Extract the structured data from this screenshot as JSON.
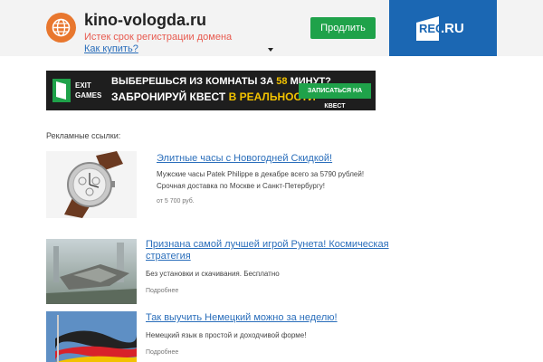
{
  "header": {
    "domain": "kino-vologda.ru",
    "expired_text": "Истек срок регистрации домена ",
    "buy_link": "Как купить?",
    "buy_button": "Продлить",
    "registrar_logo": "REG",
    "registrar_suffix": ".RU"
  },
  "banner": {
    "logo_line1": "EXIT",
    "logo_line2": "GAMES",
    "line1_a": "ВЫБЕРЕШЬСЯ ИЗ КОМНАТЫ ЗА ",
    "line1_highlight": "58",
    "line1_b": " МИНУТ?",
    "line2_a": "ЗАБРОНИРУЙ КВЕСТ ",
    "line2_highlight": "В РЕАЛЬНОСТИ",
    "cta": "ЗАПИСАТЬСЯ НА КВЕСТ"
  },
  "ads_title": "Рекламные ссылки:",
  "ads": [
    {
      "title": "Элитные часы с Новогодней Скидкой!",
      "desc_line1": "Мужские часы Patek Philippe в декабре всего за 5790 рублей!",
      "desc_line2": "Срочная доставка по Москве и Санкт-Петербургу!",
      "meta": "от 5 700 руб."
    },
    {
      "title_line1": "Признана самой лучшей игрой Рунета! Космическая",
      "title_line2": "стратегия",
      "desc": "Без установки и скачивания. Бесплатно",
      "meta": "Подробнее"
    },
    {
      "title": "Так выучить Немецкий можно за неделю!",
      "desc": "Немецкий язык в простой и доходчивой форме!",
      "meta": "Подробнее"
    }
  ],
  "colors": {
    "accent_green": "#1fa24a",
    "registrar_blue": "#1b67b3",
    "link_blue": "#2a6ebb",
    "warning_red": "#e85a4f"
  }
}
